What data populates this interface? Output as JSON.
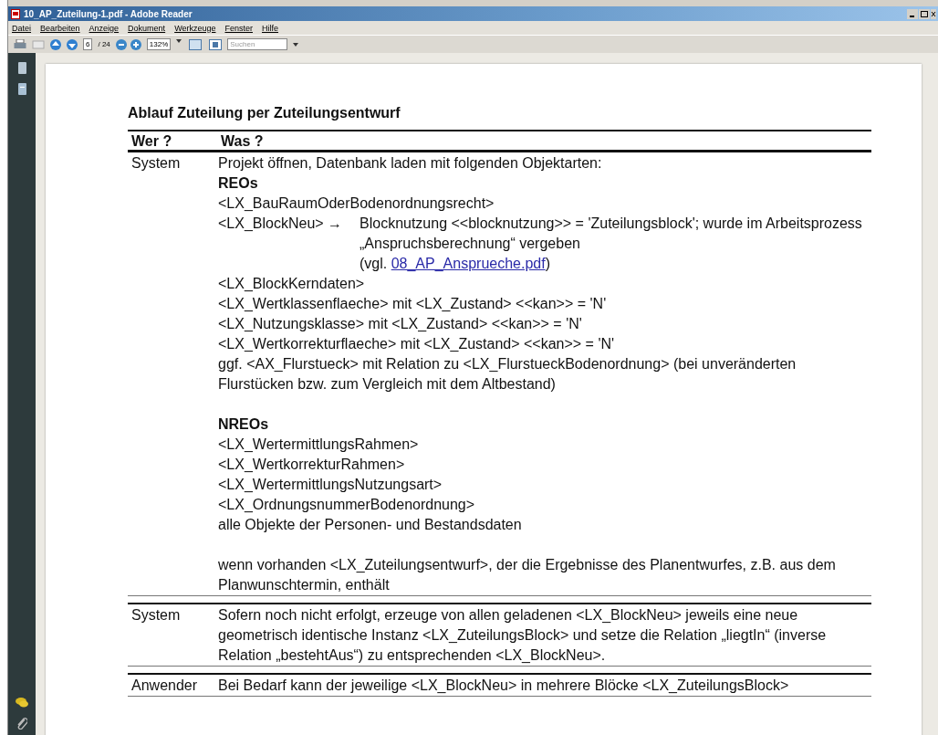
{
  "window": {
    "title": "10_AP_Zuteilung-1.pdf - Adobe Reader"
  },
  "menu": [
    "Datei",
    "Bearbeiten",
    "Anzeige",
    "Dokument",
    "Werkzeuge",
    "Fenster",
    "Hilfe"
  ],
  "toolbar": {
    "page": "6",
    "page_total": "/ 24",
    "zoom": "132%",
    "search": {
      "placeholder": "Suchen"
    }
  },
  "document": {
    "heading": "Ablauf Zuteilung per Zuteilungsentwurf",
    "columns": [
      "Wer ?",
      "Was ?"
    ],
    "rows": [
      {
        "who": "System",
        "lines": [
          {
            "kind": "plain",
            "text": "Projekt öffnen, Datenbank laden mit folgenden Objektarten:"
          },
          {
            "kind": "bold",
            "text": "REOs"
          },
          {
            "kind": "plain",
            "text": "<LX_BauRaumOderBodenordnungsrecht>"
          },
          {
            "kind": "hanging",
            "lead": "<LX_BlockNeu> →",
            "text": "Blocknutzung <<blocknutzung>> = 'Zuteilungsblock'; wurde im Arbeitsprozess „Anspruchsberechnung“ vergeben",
            "prefix": "(vgl. ",
            "link": "08_AP_Ansprueche.pdf",
            "suffix": ")"
          },
          {
            "kind": "plain",
            "text": "<LX_BlockKerndaten>"
          },
          {
            "kind": "plain",
            "text": "<LX_Wertklassenflaeche> mit <LX_Zustand> <<kan>> = 'N'"
          },
          {
            "kind": "plain",
            "text": "<LX_Nutzungsklasse> mit <LX_Zustand> <<kan>> = 'N'"
          },
          {
            "kind": "plain",
            "text": "<LX_Wertkorrekturflaeche> mit <LX_Zustand> <<kan>> = 'N'"
          },
          {
            "kind": "plain",
            "text": "ggf. <AX_Flurstueck> mit Relation zu <LX_FlurstueckBodenordnung> (bei unveränderten Flurstücken bzw. zum Vergleich mit dem Altbestand)"
          },
          {
            "kind": "bold",
            "gap": true,
            "text": "NREOs"
          },
          {
            "kind": "plain",
            "text": "<LX_WertermittlungsRahmen>"
          },
          {
            "kind": "plain",
            "text": "<LX_WertkorrekturRahmen>"
          },
          {
            "kind": "plain",
            "text": "<LX_WertermittlungsNutzungsart>"
          },
          {
            "kind": "plain",
            "text": "<LX_OrdnungsnummerBodenordnung>"
          },
          {
            "kind": "plain",
            "text": "alle Objekte der Personen- und Bestandsdaten"
          },
          {
            "kind": "plain",
            "gap": true,
            "text": "wenn vorhanden <LX_Zuteilungsentwurf>, der die Ergebnisse des Planentwurfes, z.B. aus dem Planwunschtermin, enthält"
          }
        ]
      },
      {
        "who": "System",
        "lines": [
          {
            "kind": "plain",
            "text": "Sofern noch nicht erfolgt, erzeuge von allen geladenen <LX_BlockNeu> jeweils eine neue geometrisch identische Instanz <LX_ZuteilungsBlock> und setze die Relation „liegtIn“ (inverse Relation „bestehtAus“) zu entsprechenden <LX_BlockNeu>."
          }
        ]
      },
      {
        "who": "Anwender",
        "lines": [
          {
            "kind": "plain",
            "text": "Bei Bedarf kann der jeweilige <LX_BlockNeu> in mehrere Blöcke <LX_ZuteilungsBlock>"
          }
        ]
      }
    ]
  }
}
